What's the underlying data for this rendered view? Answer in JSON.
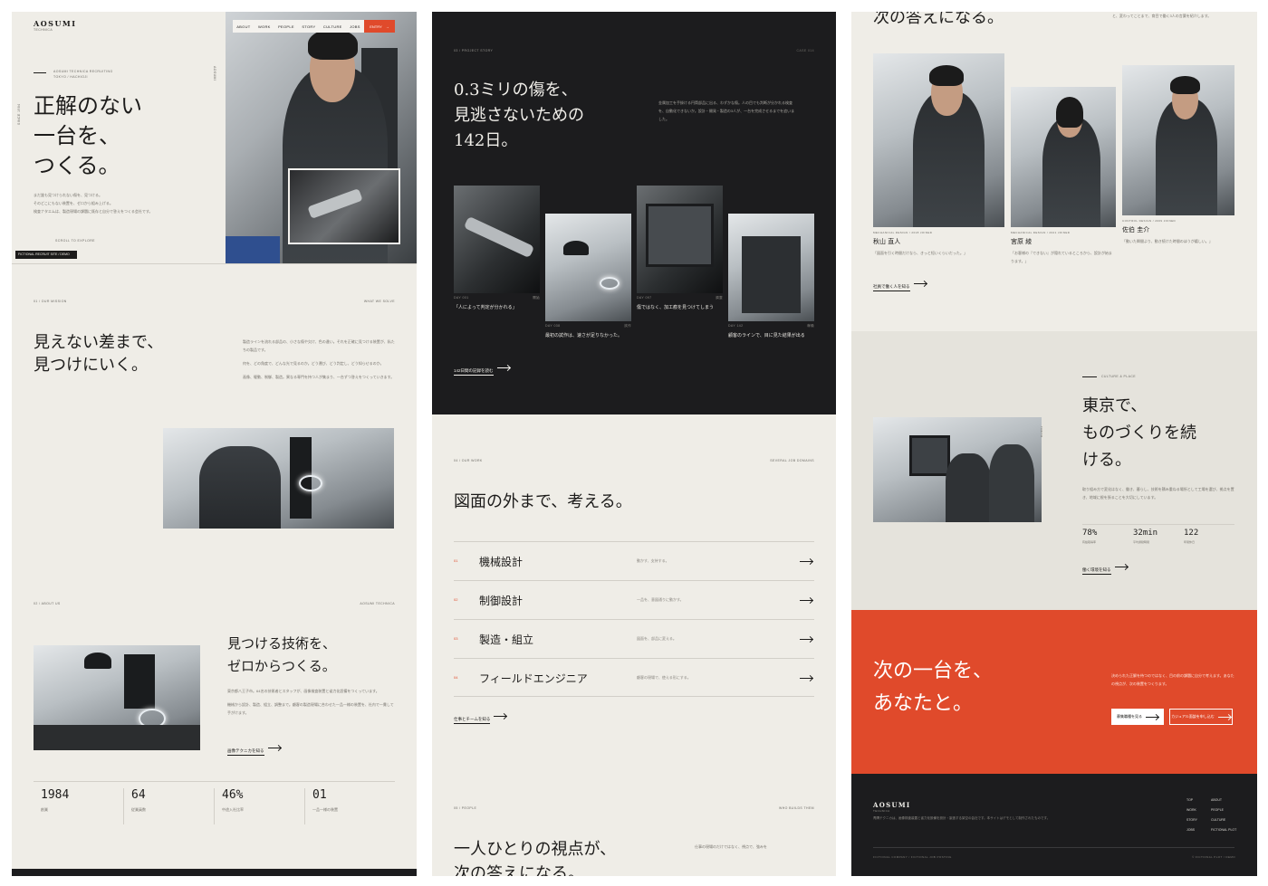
{
  "col1": {
    "brand": "AOSUMI",
    "brand_sub": "TECHNICA",
    "nav": [
      "ABOUT",
      "WORK",
      "PEOPLE",
      "STORY",
      "CULTURE",
      "JOBS"
    ],
    "entry_label": "ENTRY",
    "hero_eyebrow_1": "AOSUMI TECHNICA RECRUITING",
    "hero_eyebrow_2": "TOKYO / HACHIOJI",
    "hero_title_1": "正解のない",
    "hero_title_2": "一台を、",
    "hero_title_3": "つくる。",
    "hero_body_1": "まだ誰も見つけられない傷を、見つける。",
    "hero_body_2": "そのどこにもない装置を、ゼロから組み上げる。",
    "hero_body_3": "検査ナタエムは、製造現場の課題に既存と自分で答えをつくる会社です。",
    "scroll_label": "SCROLL TO EXPLORE",
    "side_text": "SINCE 1984",
    "photo_caption": "FICTIONAL RECRUIT SITE / DEMO",
    "s1_label": "01 / OUR MISSION",
    "s1_right": "WHAT WE SOLVE",
    "s1_title_1": "見えない差まで、",
    "s1_title_2": "見つけにいく。",
    "s1_p1": "製造ラインを流れる部品の、小さな傷や欠け、色の違い。それを正確に見つける装置が、私たちの製品です。",
    "s1_p2": "何を、どの角度で、どんな光で見るのか。どう運び、どう判定し、どう知らせるのか。",
    "s1_p3": "画像、駆動、制御、製造。異なる専門を持つ人が集まり、一台ずつ答えをつくっていきます。",
    "s2_label": "02 / ABOUT US",
    "s2_right": "AOSUMI TECHNICA",
    "s2_title_1": "見つける技術を、",
    "s2_title_2": "ゼロからつくる。",
    "s2_p1": "東京都八王子市。64名の技術者とスタッフが、画像検査装置と省力化設備をつくっています。",
    "s2_p2": "機械から設計、製造、組立、調整まで。顧客の製造現場に合わせた一品一様の装置を、社内で一貫して手がけます。",
    "s2_link": "画像テクニカを知る",
    "stats": [
      {
        "n": "1984",
        "l": "創業"
      },
      {
        "n": "64",
        "l": "従業員数"
      },
      {
        "n": "46%",
        "l": "中途入社比率"
      },
      {
        "n": "01",
        "l": "一品一様の装置"
      }
    ]
  },
  "col2": {
    "s3_label": "03 / PROJECT STORY",
    "s3_right": "CASE 014",
    "s3_title_1": "0.3ミリの傷を、",
    "s3_title_2": "見逃さないための",
    "s3_title_3": "142日。",
    "s3_body": "金属加工を手掛ける円筒部品に出る、わずかな傷。人の目でも判断が分かれる検査を、自動化できないか。設計・開発・製造の3人が、一台を完成させるまでを追いました。",
    "cards": [
      {
        "day": "DAY 001",
        "tag": "開始",
        "cap": "「人によって判定が分かれる」"
      },
      {
        "day": "DAY 038",
        "tag": "試作",
        "cap": "最初の試作は、速さが足りなかった。"
      },
      {
        "day": "DAY 097",
        "tag": "調整",
        "cap": "傷ではなく、加工痕を見つけてしまう"
      },
      {
        "day": "DAY 142",
        "tag": "稼働",
        "cap": "顧客のラインで、目に見た結果が出る"
      }
    ],
    "s3_link": "142日間の記録を読む",
    "s4_label": "04 / OUR WORK",
    "s4_right": "SEVERAL JOB DOMAINS",
    "s4_title": "図面の外まで、考える。",
    "jobs": [
      {
        "n": "01",
        "t": "機械設計",
        "d": "動かす、支持する。"
      },
      {
        "n": "02",
        "t": "制御設計",
        "d": "一品を、意図通りに動かす。"
      },
      {
        "n": "03",
        "t": "製造・組立",
        "d": "図面を、部品に変える。"
      },
      {
        "n": "04",
        "t": "フィールドエンジニア",
        "d": "顧客の現場で、使える形にする。"
      }
    ],
    "s4_link": "仕事とチームを知る",
    "s5_label": "05 / PEOPLE",
    "s5_right": "WHO BUILDS THEM",
    "s5_title_1": "一人ひとりの視点が、",
    "s5_title_2": "次の答えになる。",
    "s5_body": "仕事の現場のだけではなく、視点で、強みを"
  },
  "col3": {
    "top_title": "次の答えになる。",
    "top_body": "と、変わってことまで、育目で働く3人の言葉を紹介します。",
    "people": [
      {
        "role": "MECHANICAL DESIGN / 2018 JOINED",
        "name": "秋山 直人",
        "quote": "「図面を引く時間だけなら、きっと短いくらいだった。」"
      },
      {
        "role": "MECHANICAL DESIGN / 2021 JOINED",
        "name": "宮原 綾",
        "quote": "「お客様の『できない』が隠れているところから、設計が始まります。」"
      },
      {
        "role": "CONTROL DESIGN / 2009 JOINED",
        "name": "佐伯 圭介",
        "quote": "「動いた瞬間より、動き続けた時間のほうが嬉しい。」"
      }
    ],
    "people_link": "社員で働く人を知る",
    "culture_label": "CULTURE & PLACE",
    "culture_title_1": "東京で、",
    "culture_title_2": "ものづくりを続",
    "culture_title_3": "ける。",
    "culture_body": "取り組み方で変化はなく、働き、暮らし、技術を積み重ねる場所として工場を選び、拠点を置き、地域に根を張ることを大切にしています。",
    "culture_stats": [
      {
        "n": "78%",
        "l": "有給取得率"
      },
      {
        "n": "32min",
        "l": "平均通勤時間"
      },
      {
        "n": "122",
        "l": "年間休日"
      }
    ],
    "culture_link": "働く環境を知る",
    "cta_title_1": "次の一台を、",
    "cta_title_2": "あなたと。",
    "cta_body": "決められた正解を待つのではなく、目の前の課題に自分で考えます。あなたの視点が、次の装置をつくります。",
    "cta_btn1": "募集職種を見る",
    "cta_btn2": "カジュアル面談を申し込む",
    "footer_brand": "AOSUMI",
    "footer_sub": "TECHNICA",
    "footer_body": "青隅テクニカは、画像検査装置と省力化設備を設計・製造する架空の会社です。本サイトはデモとして制作されたものです。",
    "footer_nav_1": [
      "TOP",
      "WORK",
      "STORY",
      "JOBS"
    ],
    "footer_nav_2": [
      "ABOUT",
      "PEOPLE",
      "CULTURE",
      "FICTIONAL PLOT"
    ],
    "footer_copy": "FICTIONAL COMPANY / FICTIONAL JOB POSTING",
    "footer_right": "© FICTIONAL PLOT / DEMO"
  }
}
